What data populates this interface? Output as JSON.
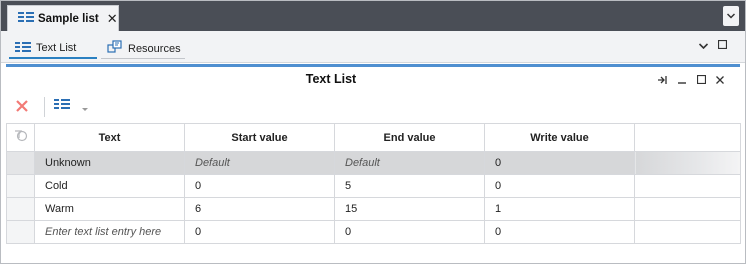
{
  "document_tab": {
    "label": "Sample list",
    "close": "✕",
    "icon": "list-icon"
  },
  "editor_tabs": [
    {
      "label": "Text List",
      "icon": "list-icon",
      "active": true
    },
    {
      "label": "Resources",
      "icon": "resources-icon",
      "active": false
    }
  ],
  "panel": {
    "title": "Text List"
  },
  "table": {
    "columns": [
      "Text",
      "Start value",
      "End value",
      "Write value"
    ],
    "rows": [
      {
        "text": "Unknown",
        "start": "Default",
        "end": "Default",
        "write": "0",
        "selected": true
      },
      {
        "text": "Cold",
        "start": "0",
        "end": "5",
        "write": "0",
        "selected": false
      },
      {
        "text": "Warm",
        "start": "6",
        "end": "15",
        "write": "1",
        "selected": false
      },
      {
        "text": "Enter text list entry here",
        "start": "0",
        "end": "0",
        "write": "0",
        "selected": false
      }
    ]
  },
  "colors": {
    "accent": "#4f8fd0",
    "tabbar": "#4a4e56",
    "delete": "#f27a75",
    "selected_row": "#d6d7d9"
  }
}
